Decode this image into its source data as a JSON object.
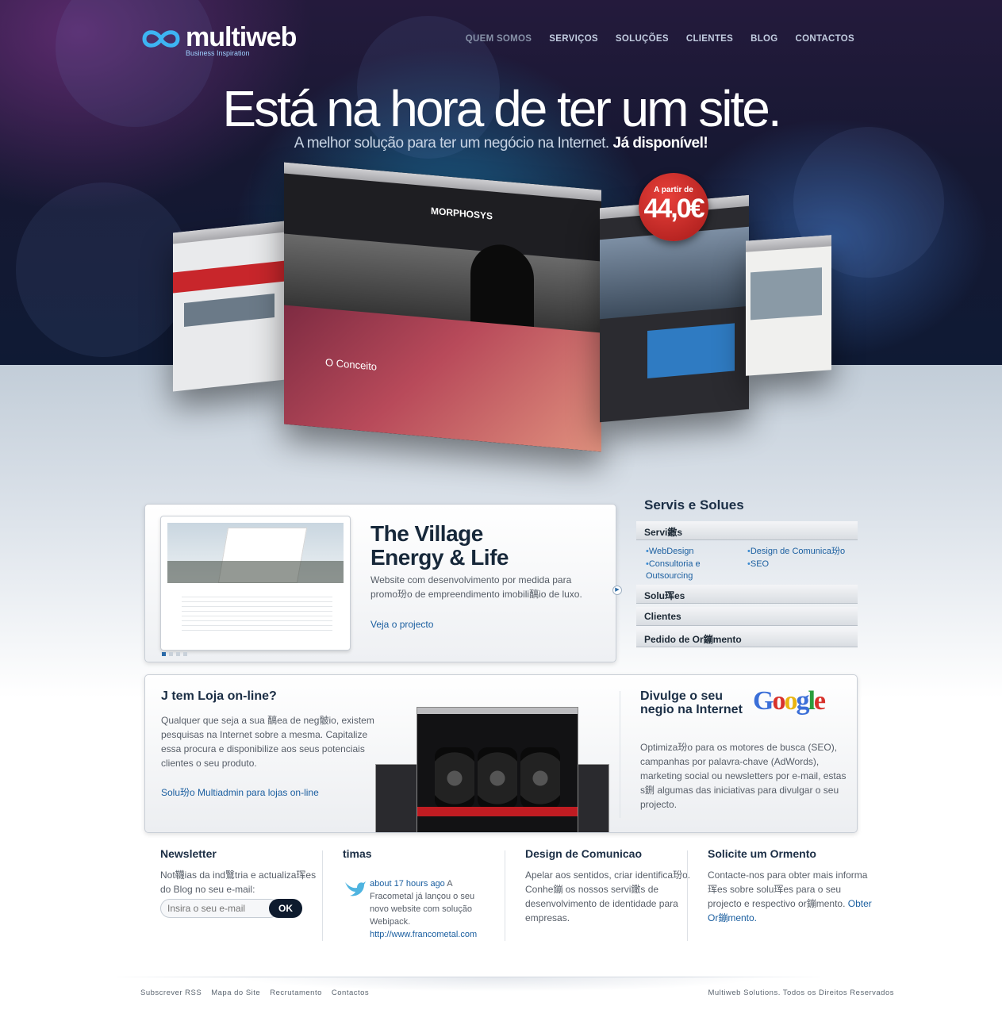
{
  "brand": {
    "name": "multiweb",
    "tagline": "Business Inspiration",
    "accent": "#3db4f2"
  },
  "nav": {
    "items": [
      {
        "label": "QUEM SOMOS",
        "active": true
      },
      {
        "label": "SERVIÇOS"
      },
      {
        "label": "SOLUÇÕES"
      },
      {
        "label": "CLIENTES"
      },
      {
        "label": "BLOG"
      },
      {
        "label": "CONTACTOS"
      }
    ]
  },
  "hero": {
    "headline": "Está na hora de ter um site.",
    "subline": "A melhor solução para ter um negócio na Internet.",
    "subline_bold": "Já disponível!",
    "badge_top": "A partir de",
    "badge_price": "44,0€",
    "mock_main_logo": "MORPHOSYS",
    "mock_main_concept": "O Conceito"
  },
  "feature": {
    "title_line1": "The Village",
    "title_line2": "Energy & Life",
    "description": "Website com desenvolvimento por medida para promo玢o de empreendimento imobili醨io de luxo.",
    "link": "Veja o projecto",
    "slide_count": 4,
    "active_slide": 1
  },
  "services": {
    "title": "Servis e Solues",
    "accordion": [
      {
        "label": "Servi鏾s"
      },
      {
        "label": "Solu珲es"
      },
      {
        "label": "Clientes"
      },
      {
        "label": "Pedido de Or鏰mento"
      }
    ],
    "links": [
      "WebDesign",
      "Design de Comunica玢o",
      "Consultoria e Outsourcing",
      "SEO"
    ]
  },
  "loja": {
    "title": "J tem Loja on-line?",
    "text": "Qualquer que seja a sua 醨ea de neg骳io, existem pesquisas na Internet sobre a mesma. Capitalize essa procura e disponibilize aos seus potenciais clientes o seu produto.",
    "link": "Solu玢o Multiadmin para lojas on-line"
  },
  "google": {
    "title": "Divulge o seu negio na Internet",
    "logo": "Google",
    "text": "Optimiza玢o para os motores de busca (SEO), campanhas por palavra-chave (AdWords), marketing social ou newsletters por e-mail, estas s鉶 algumas das iniciativas para divulgar o seu projecto."
  },
  "columns": {
    "newsletter": {
      "title": "Newsletter",
      "text": "Not韈ias da ind鷖tria e actualiza珲es do Blog no seu e-mail:",
      "placeholder": "Insira o seu e-mail",
      "button": "OK"
    },
    "tweets": {
      "title": "timas",
      "time": "about 17 hours ago",
      "text": "A Fracometal já lançou o seu novo website com solução Webipack.",
      "link": "http://www.francometal.com"
    },
    "design": {
      "title": "Design de Comunicao",
      "text": "Apelar aos sentidos, criar identifica玢o. Conhe鏰 os nossos servi鏾s de desenvolvimento de identidade para empresas."
    },
    "quote": {
      "title": "Solicite um Ormento",
      "text": "Contacte-nos para obter mais informa珲es sobre solu珲es para o seu projecto e respectivo or鏰mento.",
      "link": "Obter Or鏰mento."
    }
  },
  "footer": {
    "links": [
      "Subscrever RSS",
      "Mapa do Site",
      "Recrutamento",
      "Contactos"
    ],
    "copyright": "Multiweb Solutions. Todos os Direitos Reservados"
  }
}
